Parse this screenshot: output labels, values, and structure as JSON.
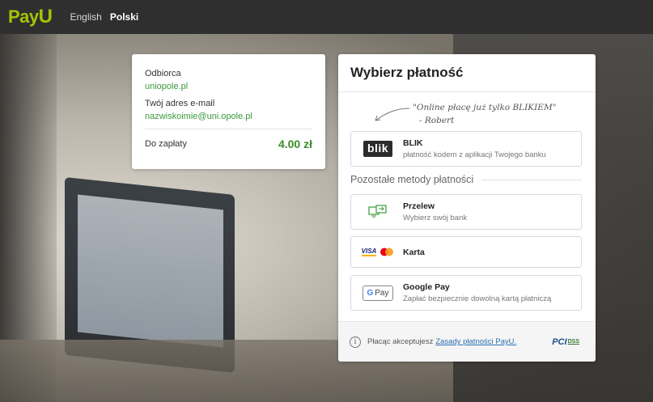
{
  "header": {
    "logo_main": "Pay",
    "logo_u": "U",
    "languages": [
      "English",
      "Polski"
    ],
    "active_language": "Polski",
    "brand_color": "#a6c307"
  },
  "summary": {
    "recipient_label": "Odbiorca",
    "recipient_value": "uniopole.pl",
    "email_label": "Twój adres e-mail",
    "email_value": "nazwiskoimie@uni.opole.pl",
    "amount_label": "Do zapłaty",
    "amount_value": "4.00 zł"
  },
  "payment": {
    "title": "Wybierz płatność",
    "quote_line1": "\"Online płacę już tylko BLIKIEM\"",
    "quote_line2": "- Robert",
    "blik": {
      "logo_text": "blik",
      "name": "BLIK",
      "description": "płatność kodem z aplikacji Twojego banku"
    },
    "other_methods_label": "Pozostałe metody płatności",
    "methods": [
      {
        "name": "Przelew",
        "description": "Wybierz swój bank",
        "icon": "bank-transfer-icon"
      },
      {
        "name": "Karta",
        "description": "",
        "icon": "visa-mastercard-icon",
        "visa_text": "VISA"
      },
      {
        "name": "Google Pay",
        "description": "Zapłać bezpiecznie dowolną kartą płatniczą",
        "icon": "google-pay-icon",
        "gpay_text": "Pay",
        "gpay_g": "G"
      }
    ],
    "footer": {
      "info_glyph": "i",
      "text": "Płacąc akceptujesz",
      "link_text": "Zasady płatności PayU.",
      "pci_text": "PCI",
      "dss_text": "DSS"
    }
  }
}
